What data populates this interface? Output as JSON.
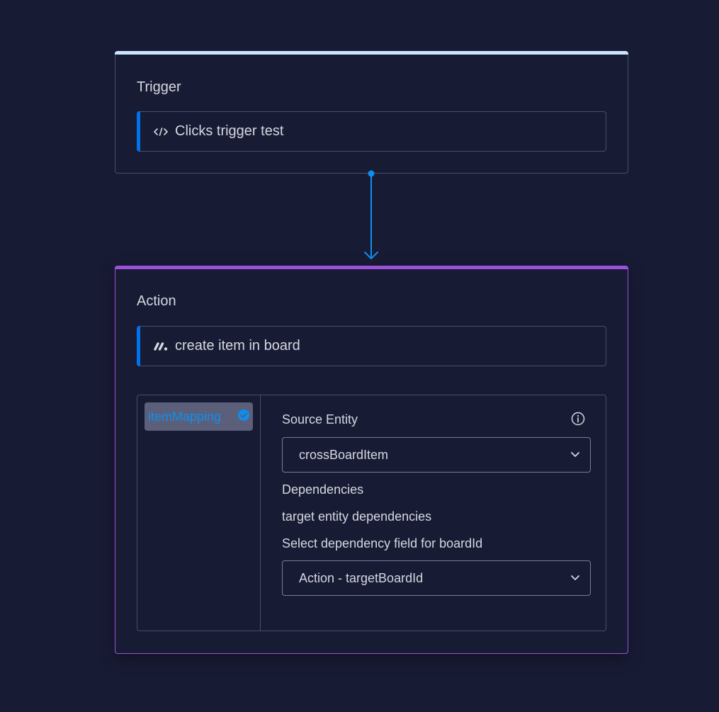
{
  "trigger": {
    "title": "Trigger",
    "selected": "Clicks trigger test",
    "icon": "code-icon"
  },
  "action": {
    "title": "Action",
    "selected": "create item in board",
    "icon": "monday-logo-icon",
    "mapping": {
      "tab": "itemMapping",
      "tab_status_icon": "check-circle-icon",
      "source_entity_label": "Source Entity",
      "source_entity_value": "crossBoardItem",
      "dependencies_label": "Dependencies",
      "target_dependencies_label": "target entity dependencies",
      "select_dependency_label": "Select dependency field for boardId",
      "select_dependency_value": "Action - targetBoardId"
    }
  },
  "colors": {
    "background": "#181b34",
    "trigger_accent": "#cce5ff",
    "action_accent": "#9d50dd",
    "primary": "#0073ea",
    "connector": "#0e8ff0"
  }
}
